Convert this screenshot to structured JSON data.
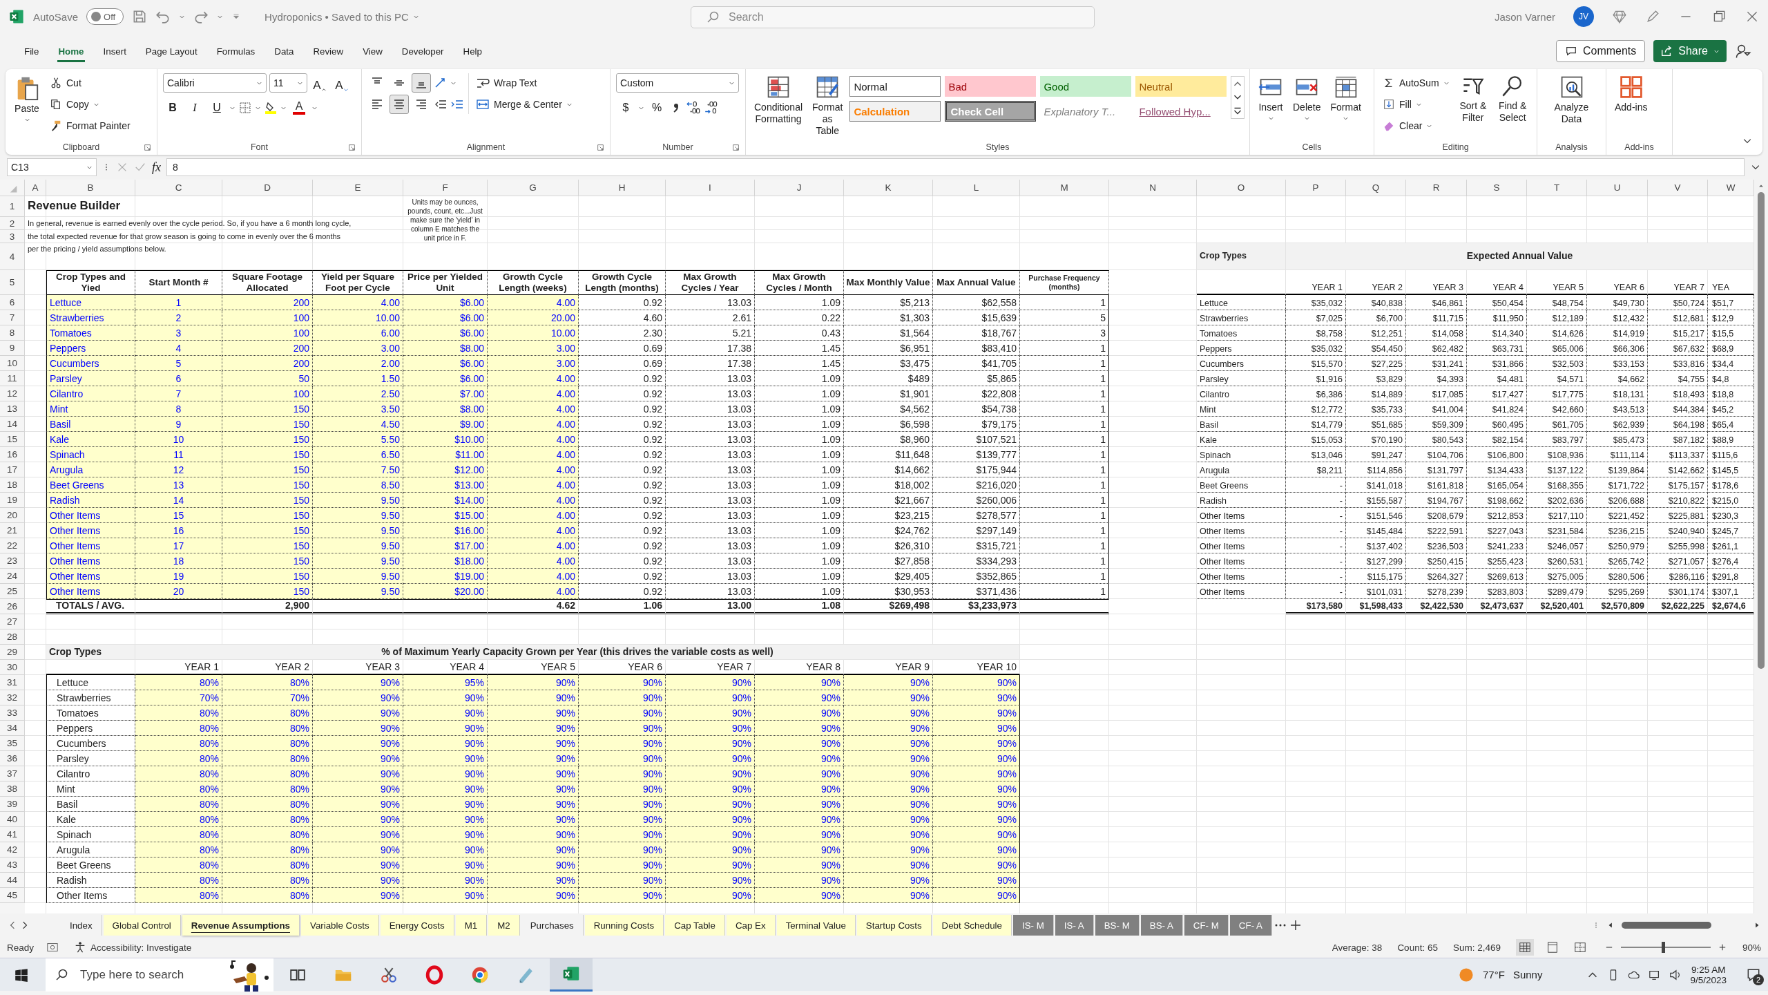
{
  "title_bar": {
    "autosave_label": "AutoSave",
    "autosave": {
      "on": false,
      "label": "Off"
    },
    "document": "Hydroponics • Saved to this PC",
    "search_placeholder": "Search",
    "user": "Jason Varner",
    "initials": "JV"
  },
  "menu_tabs": [
    {
      "label": "File",
      "selected": false
    },
    {
      "label": "Home",
      "selected": true
    },
    {
      "label": "Insert",
      "selected": false
    },
    {
      "label": "Page Layout",
      "selected": false
    },
    {
      "label": "Formulas",
      "selected": false
    },
    {
      "label": "Data",
      "selected": false
    },
    {
      "label": "Review",
      "selected": false
    },
    {
      "label": "View",
      "selected": false
    },
    {
      "label": "Developer",
      "selected": false
    },
    {
      "label": "Help",
      "selected": false
    }
  ],
  "menu_buttons": {
    "comments": "Comments",
    "share": "Share"
  },
  "ribbon": {
    "clipboard": {
      "label": "Clipboard",
      "paste": "Paste",
      "cut": "Cut",
      "copy": "Copy",
      "format_painter": "Format Painter"
    },
    "font": {
      "label": "Font",
      "family": "Calibri",
      "size": "11",
      "grow": "A",
      "shrink": "A",
      "bold": "B",
      "italic": "I",
      "underline": "U",
      "font_color_label": "A"
    },
    "alignment": {
      "label": "Alignment",
      "vertical": [
        {
          "kind": "top",
          "selected": false
        },
        {
          "kind": "middle",
          "selected": false
        },
        {
          "kind": "bottom",
          "selected": true
        }
      ],
      "horizontal": [
        {
          "kind": "left",
          "selected": false
        },
        {
          "kind": "center",
          "selected": true
        },
        {
          "kind": "right",
          "selected": false
        }
      ],
      "wrap_text": "Wrap Text",
      "merge_center": "Merge & Center"
    },
    "number": {
      "label": "Number",
      "format": "Custom",
      "currency": "$",
      "percent": "%"
    },
    "styles": {
      "label": "Styles",
      "conditional_formatting": "Conditional Formatting",
      "format_as_table": "Format as Table",
      "cell_styles": [
        {
          "name": "Normal",
          "kind": "normal"
        },
        {
          "name": "Bad",
          "kind": "bad"
        },
        {
          "name": "Good",
          "kind": "good"
        },
        {
          "name": "Neutral",
          "kind": "neutral"
        },
        {
          "name": "Calculation",
          "kind": "calculation"
        },
        {
          "name": "Check Cell",
          "kind": "check"
        },
        {
          "name": "Explanatory T...",
          "kind": "explanatory"
        },
        {
          "name": "Followed Hyp...",
          "kind": "followed"
        }
      ]
    },
    "cells": {
      "label": "Cells",
      "insert": "Insert",
      "delete": "Delete",
      "format": "Format"
    },
    "editing": {
      "label": "Editing",
      "autosum": "AutoSum",
      "fill": "Fill",
      "clear": "Clear",
      "sort_filter": "Sort & Filter",
      "find_select": "Find & Select"
    },
    "analysis": {
      "label": "Analysis",
      "analyze_data": "Analyze Data"
    },
    "addins": {
      "label": "Add-ins",
      "addins": "Add-ins"
    }
  },
  "formula_bar": {
    "name_box": "C13",
    "fx": "fx",
    "value": "8"
  },
  "columns": [
    "A",
    "B",
    "C",
    "D",
    "E",
    "F",
    "G",
    "H",
    "I",
    "J",
    "K",
    "L",
    "M",
    "N",
    "O",
    "P",
    "Q",
    "R",
    "S",
    "T",
    "U",
    "V",
    "W"
  ],
  "row_numbers": [
    "1",
    "2",
    "3",
    "4",
    "5",
    "6",
    "7",
    "8",
    "9",
    "10",
    "11",
    "12",
    "13",
    "14",
    "15",
    "16",
    "17",
    "18",
    "19",
    "20",
    "21",
    "22",
    "23",
    "24",
    "25",
    "26",
    "27",
    "28",
    "29",
    "30",
    "31",
    "32",
    "33",
    "34",
    "35",
    "36",
    "37",
    "38",
    "39",
    "40",
    "41",
    "42",
    "43",
    "44",
    "45"
  ],
  "revenue_builder": {
    "title": "Revenue Builder",
    "description": [
      "In general, revenue is earned evenly over the cycle period. So, if you have a 6 month long cycle,",
      "the total expected revenue for that grow season is going to come in evenly over the 6 months",
      "per the pricing / yield assumptions below."
    ],
    "note": "Units may be ounces, pounds, count, etc...Just make sure the 'yield' in column E matches the unit price in F.",
    "headers": [
      "Crop Types and Yied",
      "Start Month #",
      "Square Footage Allocated",
      "Yield per Square Foot per Cycle",
      "Price per Yielded Unit",
      "Growth Cycle Length (weeks)",
      "Growth Cycle Length (months)",
      "Max Growth Cycles / Year",
      "Max Growth Cycles / Month",
      "Max Monthly Value",
      "Max Annual Value",
      "Purchase Frequency (months)"
    ],
    "rows": [
      [
        "Lettuce",
        "1",
        "200",
        "4.00",
        "$6.00",
        "4.00",
        "0.92",
        "13.03",
        "1.09",
        "$5,213",
        "$62,558",
        "1"
      ],
      [
        "Strawberries",
        "2",
        "100",
        "10.00",
        "$6.00",
        "20.00",
        "4.60",
        "2.61",
        "0.22",
        "$1,303",
        "$15,639",
        "5"
      ],
      [
        "Tomatoes",
        "3",
        "100",
        "6.00",
        "$6.00",
        "10.00",
        "2.30",
        "5.21",
        "0.43",
        "$1,564",
        "$18,767",
        "3"
      ],
      [
        "Peppers",
        "4",
        "200",
        "3.00",
        "$8.00",
        "3.00",
        "0.69",
        "17.38",
        "1.45",
        "$6,951",
        "$83,410",
        "1"
      ],
      [
        "Cucumbers",
        "5",
        "200",
        "2.00",
        "$6.00",
        "3.00",
        "0.69",
        "17.38",
        "1.45",
        "$3,475",
        "$41,705",
        "1"
      ],
      [
        "Parsley",
        "6",
        "50",
        "1.50",
        "$6.00",
        "4.00",
        "0.92",
        "13.03",
        "1.09",
        "$489",
        "$5,865",
        "1"
      ],
      [
        "Cilantro",
        "7",
        "100",
        "2.50",
        "$7.00",
        "4.00",
        "0.92",
        "13.03",
        "1.09",
        "$1,901",
        "$22,808",
        "1"
      ],
      [
        "Mint",
        "8",
        "150",
        "3.50",
        "$8.00",
        "4.00",
        "0.92",
        "13.03",
        "1.09",
        "$4,562",
        "$54,738",
        "1"
      ],
      [
        "Basil",
        "9",
        "150",
        "4.50",
        "$9.00",
        "4.00",
        "0.92",
        "13.03",
        "1.09",
        "$6,598",
        "$79,175",
        "1"
      ],
      [
        "Kale",
        "10",
        "150",
        "5.50",
        "$10.00",
        "4.00",
        "0.92",
        "13.03",
        "1.09",
        "$8,960",
        "$107,521",
        "1"
      ],
      [
        "Spinach",
        "11",
        "150",
        "6.50",
        "$11.00",
        "4.00",
        "0.92",
        "13.03",
        "1.09",
        "$11,648",
        "$139,777",
        "1"
      ],
      [
        "Arugula",
        "12",
        "150",
        "7.50",
        "$12.00",
        "4.00",
        "0.92",
        "13.03",
        "1.09",
        "$14,662",
        "$175,944",
        "1"
      ],
      [
        "Beet Greens",
        "13",
        "150",
        "8.50",
        "$13.00",
        "4.00",
        "0.92",
        "13.03",
        "1.09",
        "$18,002",
        "$216,020",
        "1"
      ],
      [
        "Radish",
        "14",
        "150",
        "9.50",
        "$14.00",
        "4.00",
        "0.92",
        "13.03",
        "1.09",
        "$21,667",
        "$260,006",
        "1"
      ],
      [
        "Other Items",
        "15",
        "150",
        "9.50",
        "$15.00",
        "4.00",
        "0.92",
        "13.03",
        "1.09",
        "$23,215",
        "$278,577",
        "1"
      ],
      [
        "Other Items",
        "16",
        "150",
        "9.50",
        "$16.00",
        "4.00",
        "0.92",
        "13.03",
        "1.09",
        "$24,762",
        "$297,149",
        "1"
      ],
      [
        "Other Items",
        "17",
        "150",
        "9.50",
        "$17.00",
        "4.00",
        "0.92",
        "13.03",
        "1.09",
        "$26,310",
        "$315,721",
        "1"
      ],
      [
        "Other Items",
        "18",
        "150",
        "9.50",
        "$18.00",
        "4.00",
        "0.92",
        "13.03",
        "1.09",
        "$27,858",
        "$334,293",
        "1"
      ],
      [
        "Other Items",
        "19",
        "150",
        "9.50",
        "$19.00",
        "4.00",
        "0.92",
        "13.03",
        "1.09",
        "$29,405",
        "$352,865",
        "1"
      ],
      [
        "Other Items",
        "20",
        "150",
        "9.50",
        "$20.00",
        "4.00",
        "0.92",
        "13.03",
        "1.09",
        "$30,953",
        "$371,436",
        "1"
      ]
    ],
    "totals": {
      "label": "TOTALS / AVG.",
      "square_footage": "2,900",
      "growth_weeks": "4.62",
      "growth_months": "1.06",
      "cycles_year": "13.00",
      "cycles_month": "1.08",
      "max_monthly": "$269,498",
      "max_annual": "$3,233,973"
    }
  },
  "expected_annual_value": {
    "heading": "Crop Types",
    "title": "Expected Annual Value",
    "years": [
      "YEAR 1",
      "YEAR 2",
      "YEAR 3",
      "YEAR 4",
      "YEAR 5",
      "YEAR 6",
      "YEAR 7",
      "YEA"
    ],
    "rows": [
      {
        "crop": "Lettuce",
        "values": [
          "$35,032",
          "$40,838",
          "$46,861",
          "$50,454",
          "$48,754",
          "$49,730",
          "$50,724",
          "$51,7"
        ]
      },
      {
        "crop": "Strawberries",
        "values": [
          "$7,025",
          "$6,700",
          "$11,715",
          "$11,950",
          "$12,189",
          "$12,432",
          "$12,681",
          "$12,9"
        ]
      },
      {
        "crop": "Tomatoes",
        "values": [
          "$8,758",
          "$12,251",
          "$14,058",
          "$14,340",
          "$14,626",
          "$14,919",
          "$15,217",
          "$15,5"
        ]
      },
      {
        "crop": "Peppers",
        "values": [
          "$35,032",
          "$54,450",
          "$62,482",
          "$63,731",
          "$65,006",
          "$66,306",
          "$67,632",
          "$68,9"
        ]
      },
      {
        "crop": "Cucumbers",
        "values": [
          "$15,570",
          "$27,225",
          "$31,241",
          "$31,866",
          "$32,503",
          "$33,153",
          "$33,816",
          "$34,4"
        ]
      },
      {
        "crop": "Parsley",
        "values": [
          "$1,916",
          "$3,829",
          "$4,393",
          "$4,481",
          "$4,571",
          "$4,662",
          "$4,755",
          "$4,8"
        ]
      },
      {
        "crop": "Cilantro",
        "values": [
          "$6,386",
          "$14,889",
          "$17,085",
          "$17,427",
          "$17,775",
          "$18,131",
          "$18,493",
          "$18,8"
        ]
      },
      {
        "crop": "Mint",
        "values": [
          "$12,772",
          "$35,733",
          "$41,004",
          "$41,824",
          "$42,660",
          "$43,513",
          "$44,384",
          "$45,2"
        ]
      },
      {
        "crop": "Basil",
        "values": [
          "$14,779",
          "$51,685",
          "$59,309",
          "$60,495",
          "$61,705",
          "$62,939",
          "$64,198",
          "$65,4"
        ]
      },
      {
        "crop": "Kale",
        "values": [
          "$15,053",
          "$70,190",
          "$80,543",
          "$82,154",
          "$83,797",
          "$85,473",
          "$87,182",
          "$88,9"
        ]
      },
      {
        "crop": "Spinach",
        "values": [
          "$13,046",
          "$91,247",
          "$104,706",
          "$106,800",
          "$108,936",
          "$111,114",
          "$113,337",
          "$115,6"
        ]
      },
      {
        "crop": "Arugula",
        "values": [
          "$8,211",
          "$114,856",
          "$131,797",
          "$134,433",
          "$137,122",
          "$139,864",
          "$142,662",
          "$145,5"
        ]
      },
      {
        "crop": "Beet Greens",
        "values": [
          "-",
          "$141,018",
          "$161,818",
          "$165,054",
          "$168,355",
          "$171,722",
          "$175,157",
          "$178,6"
        ]
      },
      {
        "crop": "Radish",
        "values": [
          "-",
          "$155,587",
          "$194,767",
          "$198,662",
          "$202,636",
          "$206,688",
          "$210,822",
          "$215,0"
        ]
      },
      {
        "crop": "Other Items",
        "values": [
          "-",
          "$151,546",
          "$208,679",
          "$212,853",
          "$217,110",
          "$221,452",
          "$225,881",
          "$230,3"
        ]
      },
      {
        "crop": "Other Items",
        "values": [
          "-",
          "$145,484",
          "$222,591",
          "$227,043",
          "$231,584",
          "$236,215",
          "$240,940",
          "$245,7"
        ]
      },
      {
        "crop": "Other Items",
        "values": [
          "-",
          "$137,402",
          "$236,503",
          "$241,233",
          "$246,057",
          "$250,979",
          "$255,998",
          "$261,1"
        ]
      },
      {
        "crop": "Other Items",
        "values": [
          "-",
          "$127,299",
          "$250,415",
          "$255,423",
          "$260,531",
          "$265,742",
          "$271,057",
          "$276,4"
        ]
      },
      {
        "crop": "Other Items",
        "values": [
          "-",
          "$115,175",
          "$264,327",
          "$269,613",
          "$275,005",
          "$280,506",
          "$286,116",
          "$291,8"
        ]
      },
      {
        "crop": "Other Items",
        "values": [
          "-",
          "$101,031",
          "$278,239",
          "$283,803",
          "$289,479",
          "$295,269",
          "$301,174",
          "$307,1"
        ]
      }
    ],
    "totals": [
      "$173,580",
      "$1,598,433",
      "$2,422,530",
      "$2,473,637",
      "$2,520,401",
      "$2,570,809",
      "$2,622,225",
      "$2,674,6"
    ]
  },
  "capacity": {
    "heading": "Crop Types",
    "title": "% of Maximum Yearly Capacity Grown per Year (this drives the variable costs as well)",
    "years": [
      "YEAR 1",
      "YEAR 2",
      "YEAR 3",
      "YEAR 4",
      "YEAR 5",
      "YEAR 6",
      "YEAR 7",
      "YEAR 8",
      "YEAR 9",
      "YEAR 10"
    ],
    "rows": [
      {
        "crop": "Lettuce",
        "values": [
          "80%",
          "80%",
          "90%",
          "95%",
          "90%",
          "90%",
          "90%",
          "90%",
          "90%",
          "90%"
        ]
      },
      {
        "crop": "Strawberries",
        "values": [
          "70%",
          "70%",
          "90%",
          "90%",
          "90%",
          "90%",
          "90%",
          "90%",
          "90%",
          "90%"
        ]
      },
      {
        "crop": "Tomatoes",
        "values": [
          "80%",
          "80%",
          "90%",
          "90%",
          "90%",
          "90%",
          "90%",
          "90%",
          "90%",
          "90%"
        ]
      },
      {
        "crop": "Peppers",
        "values": [
          "80%",
          "80%",
          "90%",
          "90%",
          "90%",
          "90%",
          "90%",
          "90%",
          "90%",
          "90%"
        ]
      },
      {
        "crop": "Cucumbers",
        "values": [
          "80%",
          "80%",
          "90%",
          "90%",
          "90%",
          "90%",
          "90%",
          "90%",
          "90%",
          "90%"
        ]
      },
      {
        "crop": "Parsley",
        "values": [
          "80%",
          "80%",
          "90%",
          "90%",
          "90%",
          "90%",
          "90%",
          "90%",
          "90%",
          "90%"
        ]
      },
      {
        "crop": "Cilantro",
        "values": [
          "80%",
          "80%",
          "90%",
          "90%",
          "90%",
          "90%",
          "90%",
          "90%",
          "90%",
          "90%"
        ]
      },
      {
        "crop": "Mint",
        "values": [
          "80%",
          "80%",
          "90%",
          "90%",
          "90%",
          "90%",
          "90%",
          "90%",
          "90%",
          "90%"
        ]
      },
      {
        "crop": "Basil",
        "values": [
          "80%",
          "80%",
          "90%",
          "90%",
          "90%",
          "90%",
          "90%",
          "90%",
          "90%",
          "90%"
        ]
      },
      {
        "crop": "Kale",
        "values": [
          "80%",
          "80%",
          "90%",
          "90%",
          "90%",
          "90%",
          "90%",
          "90%",
          "90%",
          "90%"
        ]
      },
      {
        "crop": "Spinach",
        "values": [
          "80%",
          "80%",
          "90%",
          "90%",
          "90%",
          "90%",
          "90%",
          "90%",
          "90%",
          "90%"
        ]
      },
      {
        "crop": "Arugula",
        "values": [
          "80%",
          "80%",
          "90%",
          "90%",
          "90%",
          "90%",
          "90%",
          "90%",
          "90%",
          "90%"
        ]
      },
      {
        "crop": "Beet Greens",
        "values": [
          "80%",
          "80%",
          "90%",
          "90%",
          "90%",
          "90%",
          "90%",
          "90%",
          "90%",
          "90%"
        ]
      },
      {
        "crop": "Radish",
        "values": [
          "80%",
          "80%",
          "90%",
          "90%",
          "90%",
          "90%",
          "90%",
          "90%",
          "90%",
          "90%"
        ]
      },
      {
        "crop": "Other Items",
        "values": [
          "80%",
          "80%",
          "90%",
          "90%",
          "90%",
          "90%",
          "90%",
          "90%",
          "90%",
          "90%"
        ]
      }
    ]
  },
  "sheet_tabs": [
    {
      "label": "Index",
      "selected": false
    },
    {
      "label": "Global Control",
      "selected": false,
      "color": "#ffffcc"
    },
    {
      "label": "Revenue Assumptions",
      "selected": true,
      "color": "#ffffcc"
    },
    {
      "label": "Variable Costs",
      "selected": false,
      "color": "#ffffcc"
    },
    {
      "label": "Energy Costs",
      "selected": false,
      "color": "#ffffcc"
    },
    {
      "label": "M1",
      "selected": false,
      "color": "#ffffcc"
    },
    {
      "label": "M2",
      "selected": false,
      "color": "#ffffcc"
    },
    {
      "label": "Purchases",
      "selected": false
    },
    {
      "label": "Running Costs",
      "selected": false,
      "color": "#ffffcc"
    },
    {
      "label": "Cap Table",
      "selected": false,
      "color": "#ffffcc"
    },
    {
      "label": "Cap Ex",
      "selected": false,
      "color": "#ffffcc"
    },
    {
      "label": "Terminal Value",
      "selected": false,
      "color": "#ffffcc"
    },
    {
      "label": "Startup Costs",
      "selected": false,
      "color": "#ffffcc"
    },
    {
      "label": "Debt Schedule",
      "selected": false,
      "color": "#ffffcc"
    },
    {
      "label": "IS- M",
      "selected": false,
      "color": "#808080"
    },
    {
      "label": "IS- A",
      "selected": false,
      "color": "#808080"
    },
    {
      "label": "BS- M",
      "selected": false,
      "color": "#808080"
    },
    {
      "label": "BS- A",
      "selected": false,
      "color": "#808080"
    },
    {
      "label": "CF- M",
      "selected": false,
      "color": "#808080"
    },
    {
      "label": "CF- A",
      "selected": false,
      "color": "#808080"
    }
  ],
  "status_bar": {
    "mode": "Ready",
    "accessibility": "Accessibility: Investigate",
    "average": "Average: 38",
    "count": "Count: 65",
    "sum": "Sum: 2,469",
    "views": [
      {
        "kind": "normal",
        "selected": true
      },
      {
        "kind": "page_layout",
        "selected": false
      },
      {
        "kind": "page_break",
        "selected": false
      }
    ],
    "zoom": {
      "level": 0.47,
      "label": "90%"
    }
  },
  "taskbar": {
    "search_placeholder": "Type here to search",
    "apps": [
      {
        "kind": "task_view",
        "active": false
      },
      {
        "kind": "explorer",
        "active": false
      },
      {
        "kind": "snip",
        "active": false
      },
      {
        "kind": "opera",
        "active": false
      },
      {
        "kind": "chrome",
        "active": false
      },
      {
        "kind": "notes",
        "active": false
      },
      {
        "kind": "excel",
        "active": true
      }
    ],
    "temperature": "77°F",
    "weather": "Sunny",
    "time": "9:25 AM",
    "date": "9/5/2023",
    "notifications": "2"
  }
}
